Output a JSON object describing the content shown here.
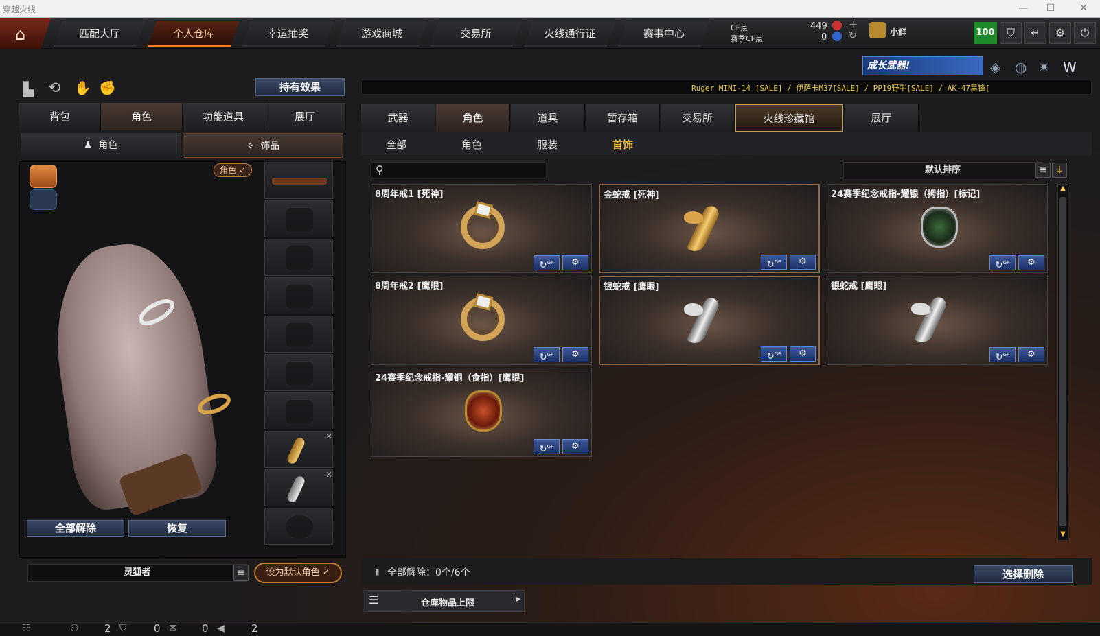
{
  "window": {
    "title": "穿越火线"
  },
  "nav": {
    "tabs": [
      "匹配大厅",
      "个人仓库",
      "幸运抽奖",
      "游戏商城",
      "交易所",
      "火线通行证",
      "赛事中心"
    ],
    "active": 1
  },
  "currency": {
    "cf_label": "CF点",
    "season_label": "赛季CF点",
    "cf_value": "449",
    "season_value": "0",
    "username": "小鲜",
    "level": "100"
  },
  "left": {
    "effect_button": "持有效果",
    "tabs": [
      "背包",
      "角色",
      "功能道具",
      "展厅"
    ],
    "active_tab": 1,
    "subtabs": [
      "角色",
      "饰品"
    ],
    "active_subtab": 1,
    "role_badge": "角色 ✓",
    "unequip_all": "全部解除",
    "restore": "恢复",
    "role_name": "灵狐者",
    "set_default": "设为默认角色 ✓"
  },
  "right": {
    "banner_text": "成长武器!",
    "ticker": "Ruger MINI-14  [SALE] / 伊萨卡M37[SALE] / PP19野牛[SALE] / AK-47黑锋[",
    "tabs": [
      "武器",
      "角色",
      "道具",
      "暂存箱",
      "交易所",
      "火线珍藏馆",
      "展厅"
    ],
    "active_tab": 1,
    "highlight_tab": 5,
    "subtabs": [
      "全部",
      "角色",
      "服装",
      "首饰"
    ],
    "active_subtab": 3,
    "sort_label": "默认排序",
    "items": [
      {
        "name": "8周年戒1 [死神]",
        "type": "ring"
      },
      {
        "name": "金蛇戒 [死神]",
        "type": "gold-snake",
        "selected": true
      },
      {
        "name": "24赛季纪念戒指-耀银（拇指）[标记]",
        "type": "green-jewel"
      },
      {
        "name": "8周年戒2 [鹰眼]",
        "type": "ring"
      },
      {
        "name": "银蛇戒 [鹰眼]",
        "type": "silver-snake",
        "selected": true
      },
      {
        "name": "银蛇戒 [鹰眼]",
        "type": "silver-snake"
      },
      {
        "name": "24赛季纪念戒指-耀铜（食指）[鹰眼]",
        "type": "red-jewel"
      }
    ],
    "gp_label": "GP",
    "unequip_count": "全部解除：0个/6个",
    "select_delete": "选择删除",
    "storage_limit": "仓库物品上限"
  },
  "statusbar": {
    "v1": "2",
    "v2": "0",
    "v3": "0",
    "v4": "2"
  }
}
